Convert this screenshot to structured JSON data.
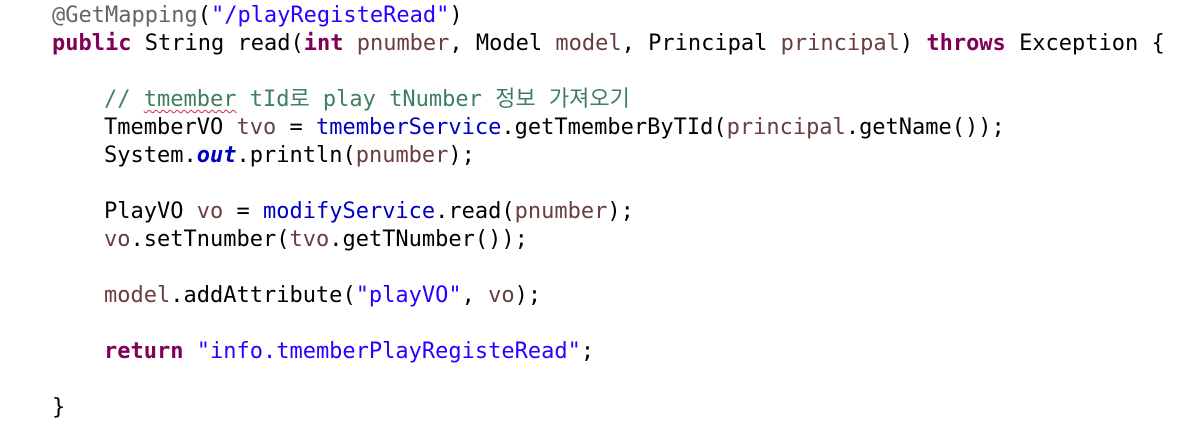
{
  "code": {
    "annotation": "@GetMapping",
    "mapping_path": "\"/playRegisteRead\"",
    "kw_public": "public",
    "type_string": "String",
    "method_name": "read",
    "kw_int": "int",
    "param_pnumber": "pnumber",
    "type_model": "Model",
    "param_model": "model",
    "type_principal": "Principal",
    "param_principal": "principal",
    "kw_throws": "throws",
    "type_exception": "Exception",
    "comment_prefix": "// ",
    "comment_word1": "tmember",
    "comment_rest": " tId로 play tNumber 정보 가져오기",
    "type_tmembervo": "TmemberVO",
    "var_tvo": "tvo",
    "field_tmemberservice": "tmemberService",
    "call_get_tmember": "getTmemberByTId",
    "call_getname": "getName",
    "type_system": "System",
    "field_out": "out",
    "call_println": "println",
    "type_playvo": "PlayVO",
    "var_vo": "vo",
    "field_modifyservice": "modifyService",
    "call_read": "read",
    "call_settnumber": "setTnumber",
    "call_gettnumber": "getTNumber",
    "call_addattribute": "addAttribute",
    "str_playvo": "\"playVO\"",
    "kw_return": "return",
    "str_view": "\"info.tmemberPlayRegisteRead\"",
    "brace_open": "{",
    "brace_close": "}"
  }
}
